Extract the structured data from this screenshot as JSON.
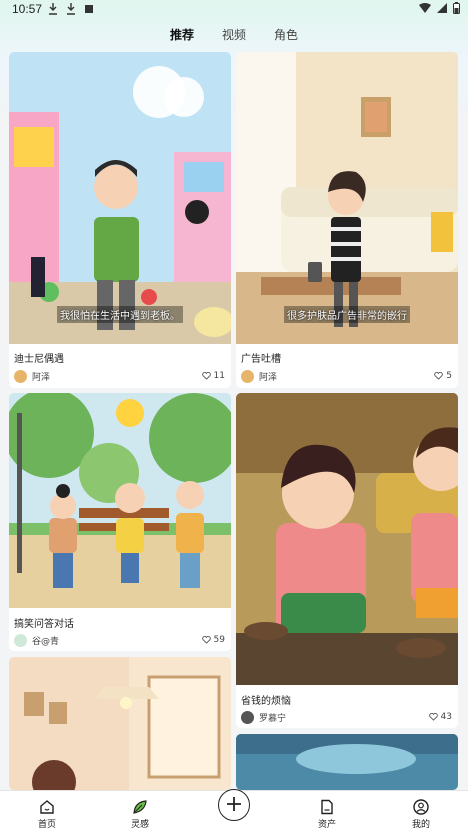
{
  "status_bar": {
    "time": "10:57"
  },
  "tabs": [
    {
      "label": "推荐",
      "active": true
    },
    {
      "label": "视频",
      "active": false
    },
    {
      "label": "角色",
      "active": false
    }
  ],
  "cards": [
    {
      "title": "迪士尼偶遇",
      "caption": "我很怕在生活中遇到老板。",
      "author": "阿泽",
      "likes": "11"
    },
    {
      "title": "广告吐槽",
      "caption": "很多护肤品广告非常的嵌行",
      "author": "阿泽",
      "likes": "5"
    },
    {
      "title": "搞笑问答对话",
      "author": "谷@青",
      "likes": "59"
    },
    {
      "title": "省钱的烦恼",
      "author": "罗慕宁",
      "likes": "43"
    },
    {
      "title": ""
    },
    {
      "title": ""
    }
  ],
  "bottom_nav": [
    {
      "label": "首页",
      "icon": "home-icon"
    },
    {
      "label": "灵感",
      "icon": "leaf-icon"
    },
    {
      "label": "",
      "icon": "add-icon"
    },
    {
      "label": "资产",
      "icon": "file-icon"
    },
    {
      "label": "我的",
      "icon": "user-icon"
    }
  ],
  "colors": {
    "accent": "#4caf50",
    "background": "#f2f4f6"
  }
}
